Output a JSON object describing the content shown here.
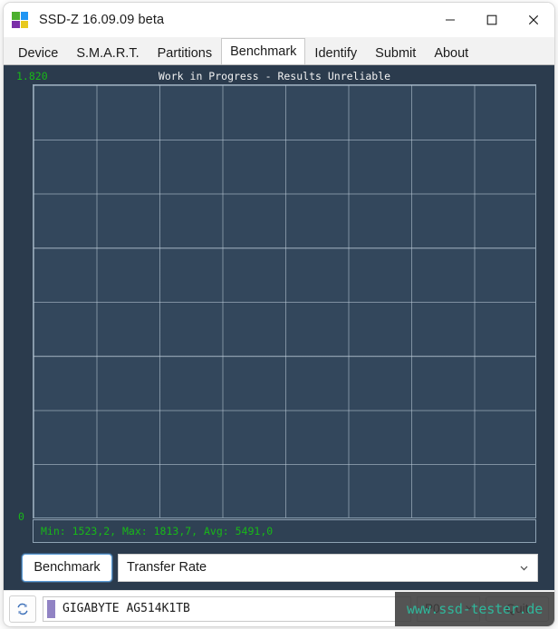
{
  "window": {
    "title": "SSD-Z 16.09.09 beta",
    "icon": "ssdz-logo-icon",
    "minimize_label": "minimize-icon",
    "maximize_label": "maximize-icon",
    "close_label": "close-icon"
  },
  "tabs": [
    {
      "label": "Device",
      "active": false
    },
    {
      "label": "S.M.A.R.T.",
      "active": false
    },
    {
      "label": "Partitions",
      "active": false
    },
    {
      "label": "Benchmark",
      "active": true
    },
    {
      "label": "Identify",
      "active": false
    },
    {
      "label": "Submit",
      "active": false
    },
    {
      "label": "About",
      "active": false
    }
  ],
  "benchmark": {
    "chart_title": "Work in Progress - Results Unreliable",
    "y_max_label": "1.820",
    "y_min_label": "0",
    "stats_text": "Min: 1523,2, Max: 1813,7, Avg: 5491,0",
    "run_button": "Benchmark",
    "mode_selected": "Transfer Rate",
    "mode_chevron": "chevron-down-icon"
  },
  "statusbar": {
    "refresh_icon": "refresh-icon",
    "drive_name": "GIGABYTE AG514K1TB",
    "drive_swatch_color": "#9183c4",
    "port_selected": "P0",
    "port_chevron": "chevron-down-icon",
    "quit_label": "Quit"
  },
  "watermark": {
    "text": "www.ssd-tester.de"
  },
  "chart_data": {
    "type": "line",
    "title": "Work in Progress - Results Unreliable",
    "xlabel": "",
    "ylabel": "",
    "ylim": [
      0,
      1.82
    ],
    "ytick_labels": [
      "1.820",
      "0"
    ],
    "grid": true,
    "grid_columns": 8,
    "grid_rows": 8,
    "series": [
      {
        "name": "Transfer Rate",
        "x": [],
        "values": []
      }
    ],
    "annotations": [
      "Min: 1523,2",
      "Max: 1813,7",
      "Avg: 5491,0"
    ],
    "stats": {
      "min": 1523.2,
      "max": 1813.7,
      "avg": 5491.0
    },
    "background_color": "#33475c",
    "grid_color": "#becdda",
    "label_color": "#18b818"
  }
}
